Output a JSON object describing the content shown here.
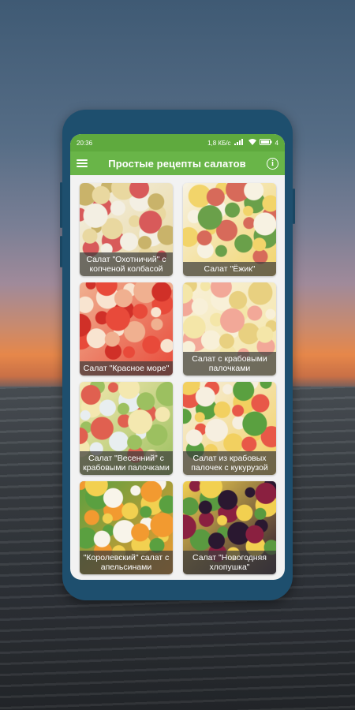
{
  "status": {
    "time": "20:36",
    "right": "1,8 КБ/с",
    "battery": "4"
  },
  "appbar": {
    "title": "Простые рецепты салатов",
    "menu_icon": "hamburger-menu-icon",
    "info_icon": "info-icon",
    "info_glyph": "i"
  },
  "recipes": [
    {
      "label": "Салат \"Охотничий\" с копченой колбасой",
      "palette": [
        "#e9d8a0",
        "#d85a5a",
        "#f3efe3",
        "#c9b36a"
      ]
    },
    {
      "label": "Салат \"Ёжик\"",
      "palette": [
        "#f2d46a",
        "#d76a5a",
        "#f7f2e2",
        "#6aa04a"
      ]
    },
    {
      "label": "Салат \"Красное море\"",
      "palette": [
        "#e84a3a",
        "#f8e4d0",
        "#f0b090",
        "#d03028"
      ]
    },
    {
      "label": "Салат с крабовыми палочками",
      "palette": [
        "#f4e6a8",
        "#f2a898",
        "#f8f0d8",
        "#e8d080"
      ]
    },
    {
      "label": "Салат \"Весенний\" с крабовыми палочками",
      "palette": [
        "#9cc060",
        "#e06050",
        "#f4e8b0",
        "#e8eef0"
      ]
    },
    {
      "label": "Салат из крабовых палочек с кукурузой",
      "palette": [
        "#f2d060",
        "#e85848",
        "#f6efe0",
        "#5aa040"
      ]
    },
    {
      "label": "\"Королевский\" салат с апельсинами",
      "palette": [
        "#f29a30",
        "#f2d050",
        "#5aa040",
        "#f8f4ea"
      ]
    },
    {
      "label": "Салат \"Новогодняя хлопушка\"",
      "palette": [
        "#2a1830",
        "#8a2040",
        "#f2d050",
        "#5a9a40"
      ]
    }
  ]
}
